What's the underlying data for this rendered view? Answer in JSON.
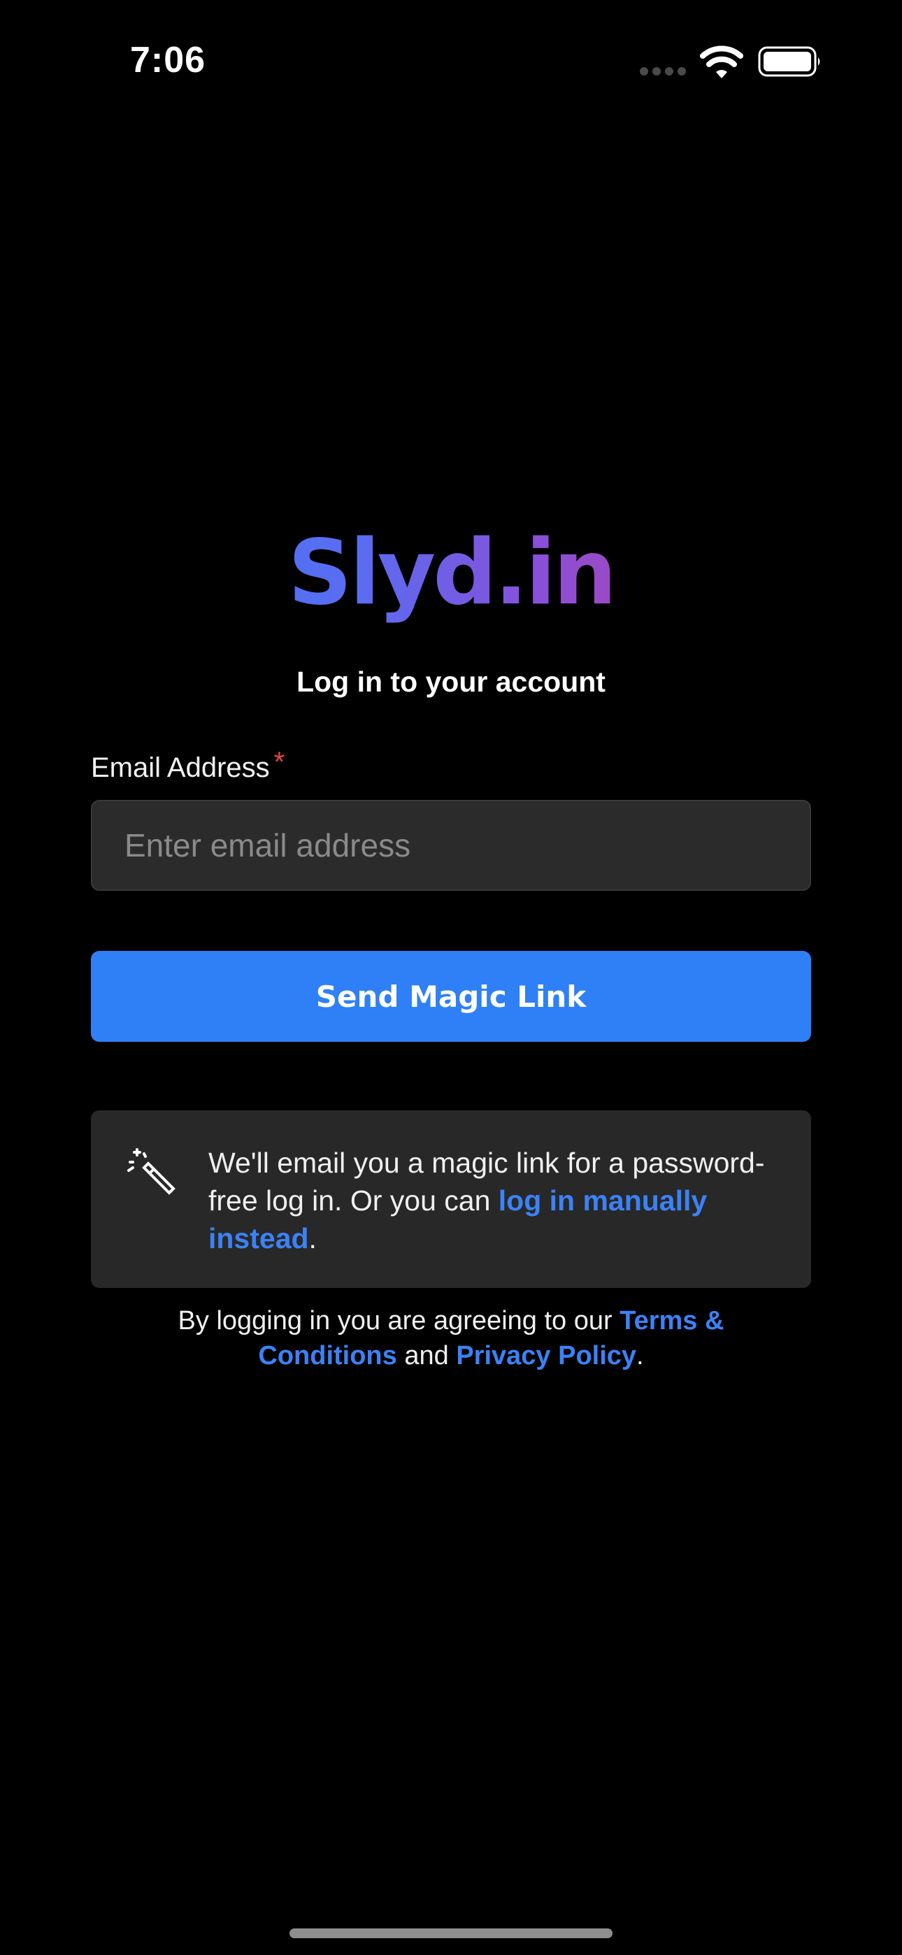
{
  "status_bar": {
    "time": "7:06",
    "icons": [
      "signal-dots-icon",
      "wifi-icon",
      "battery-icon"
    ]
  },
  "logo": {
    "text": "Slyd.in",
    "gradient_colors": [
      "#3b7bff",
      "#8a4fd9",
      "#d8356e"
    ]
  },
  "heading": "Log in to your account",
  "form": {
    "email_label": "Email Address",
    "required_mark": "*",
    "email_placeholder": "Enter email address",
    "email_value": "",
    "submit_label": "Send Magic Link"
  },
  "info": {
    "icon": "magic-wand-icon",
    "text_before": "We'll email you a magic link for a password-free log in. Or you can ",
    "link_text": "log in manually instead",
    "text_after": "."
  },
  "terms": {
    "prefix": "By logging in you are agreeing to our ",
    "terms_link": "Terms & Conditions",
    "middle": " and ",
    "privacy_link": "Privacy Policy",
    "suffix": "."
  },
  "colors": {
    "background": "#000000",
    "accent": "#2f80f7",
    "link": "#3b82f6",
    "required": "#e5484d",
    "surface": "#282828"
  }
}
